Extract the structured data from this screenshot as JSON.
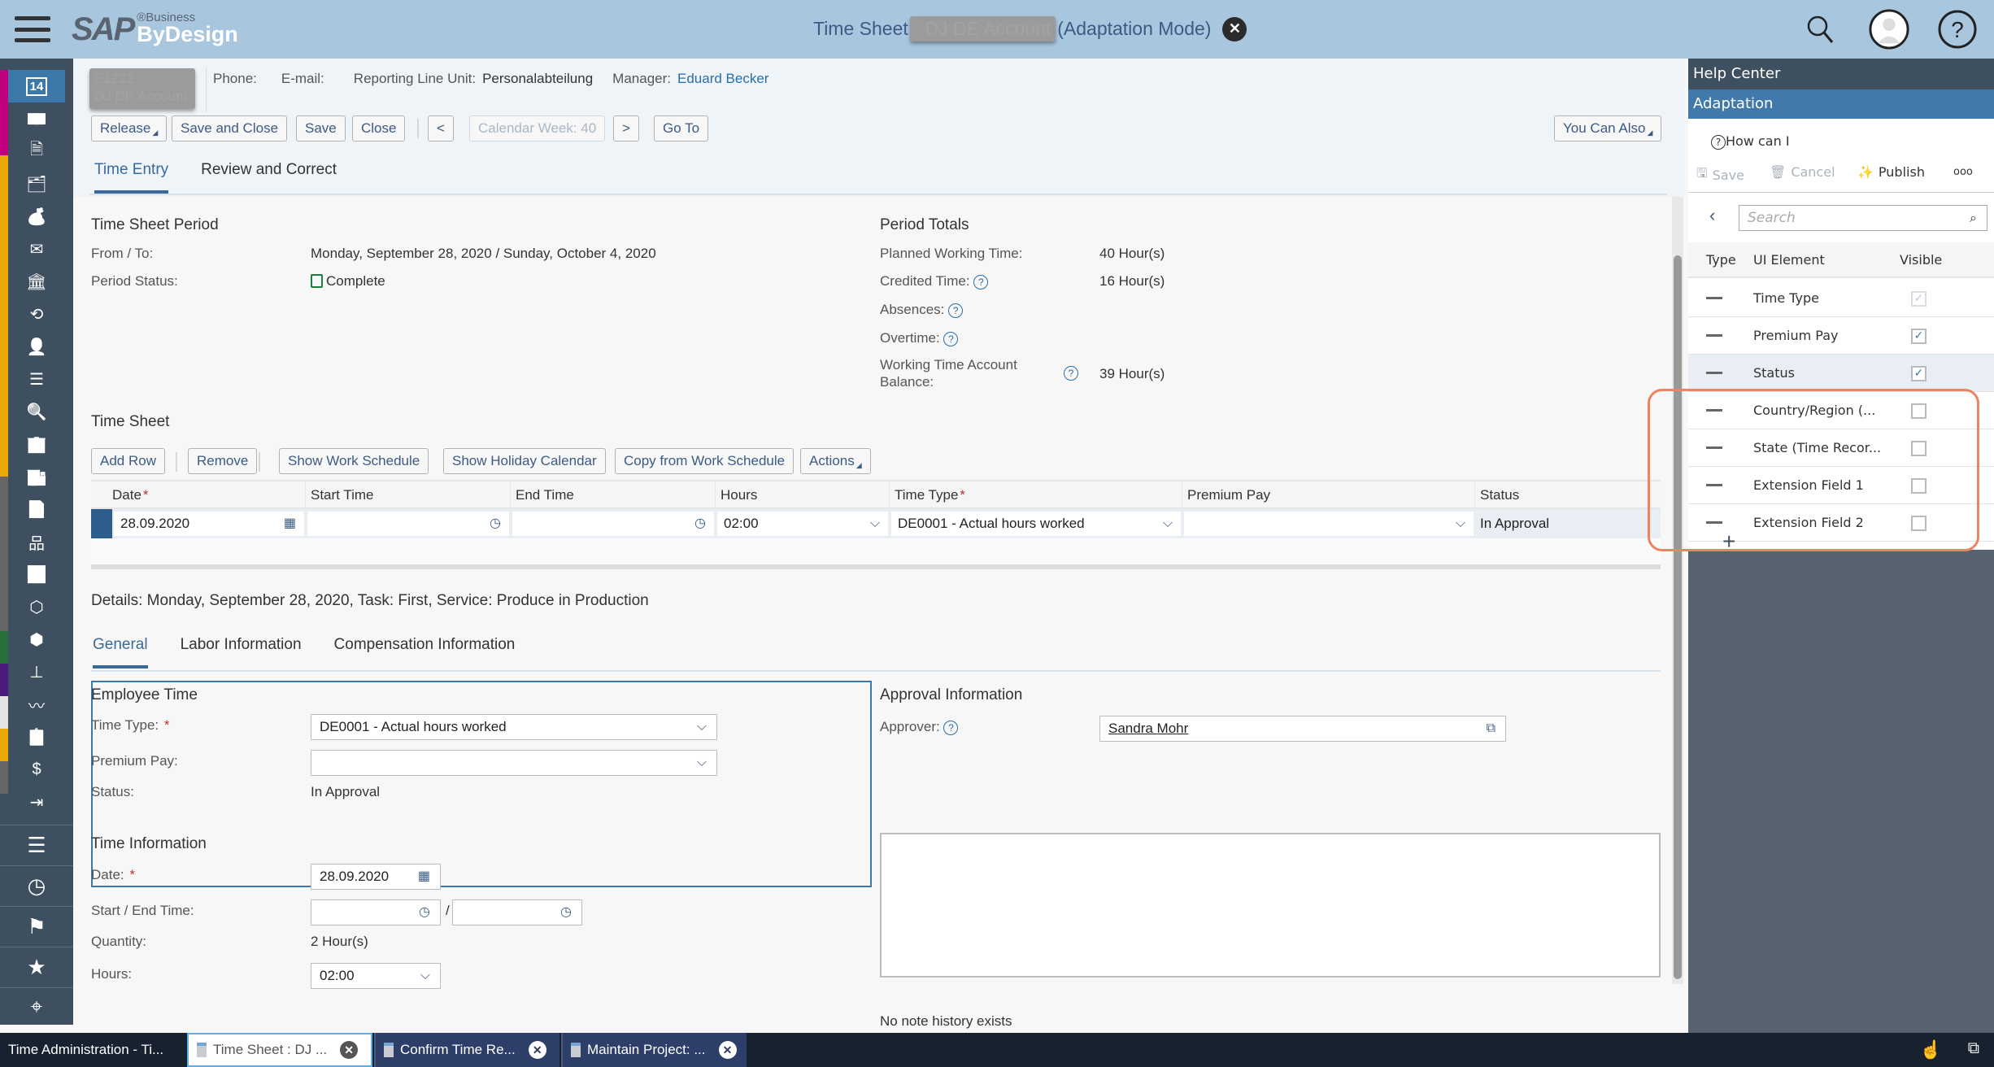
{
  "app": {
    "title_prefix": "Time Sheet",
    "title_masked": ": DJ DE Account",
    "title_suffix": "(Adaptation Mode)",
    "logo_main": "SAP",
    "logo_business": "®Business",
    "logo_bydesign": "ByDesign"
  },
  "topbar_icons": [
    "search-icon",
    "user-avatar-icon",
    "help-icon"
  ],
  "sidebar": {
    "icons": [
      "calendar-icon",
      "cash-icon",
      "invoice-icon",
      "folder-money-icon",
      "money-bag-icon",
      "envelope-money-icon",
      "bank-icon",
      "currency-exchange-icon",
      "customer-payment-icon",
      "list-icon",
      "tax-search-icon",
      "building-icon",
      "building-money-icon",
      "document-money-icon",
      "org-chart-icon",
      "analytics-icon",
      "box-icon",
      "product-icon",
      "hierarchy-icon",
      "chart-wave-icon",
      "clipboard-icon",
      "dollar-icon",
      "transfer-icon"
    ],
    "active_icon": "14",
    "bottom_icons": [
      "work-list-icon",
      "clock-icon",
      "flag-icon",
      "favorites-icon",
      "tag-icon"
    ]
  },
  "header": {
    "employee_id": "E1222",
    "employee_name": "DJ DE Account",
    "phone_label": "Phone:",
    "email_label": "E-mail:",
    "reporting_line_label": "Reporting Line Unit:",
    "reporting_line_value": "Personalabteilung",
    "manager_label": "Manager:",
    "manager_value": "Eduard Becker"
  },
  "toolbar": {
    "release": "Release",
    "save_close": "Save and Close",
    "save": "Save",
    "close": "Close",
    "prev": "<",
    "calendar_week": "Calendar Week: 40",
    "next": ">",
    "goto": "Go To",
    "you_can_also": "You Can Also"
  },
  "tabs": {
    "time_entry": "Time Entry",
    "review": "Review and Correct"
  },
  "period": {
    "title": "Time Sheet Period",
    "from_to_label": "From / To:",
    "from_to_value": "Monday, September 28, 2020 / Sunday, October 4, 2020",
    "status_label": "Period Status:",
    "status_value": "Complete"
  },
  "totals": {
    "title": "Period Totals",
    "planned_label": "Planned Working Time:",
    "planned_value": "40 Hour(s)",
    "credited_label": "Credited Time:",
    "credited_value": "16 Hour(s)",
    "absences_label": "Absences:",
    "overtime_label": "Overtime:",
    "wta_label_1": "Working Time Account",
    "wta_label_2": "Balance:",
    "wta_value": "39 Hour(s)"
  },
  "timesheet": {
    "title": "Time Sheet",
    "buttons": {
      "add_row": "Add Row",
      "remove": "Remove",
      "show_work": "Show Work Schedule",
      "show_holiday": "Show Holiday Calendar",
      "copy": "Copy from Work Schedule",
      "actions": "Actions"
    },
    "columns": [
      "Date",
      "Start Time",
      "End Time",
      "Hours",
      "Time Type",
      "Premium Pay",
      "Status"
    ],
    "rows": [
      {
        "date": "28.09.2020",
        "start": "",
        "end": "",
        "hours": "02:00",
        "time_type": "DE0001 - Actual hours worked",
        "premium": "",
        "status": "In Approval"
      }
    ]
  },
  "details": {
    "title": "Details: Monday, September 28, 2020, Task: First, Service: Produce in Production",
    "tabs": [
      "General",
      "Labor Information",
      "Compensation Information"
    ],
    "employee_time": {
      "title": "Employee Time",
      "time_type_label": "Time Type:",
      "time_type_value": "DE0001 - Actual hours worked",
      "premium_label": "Premium Pay:",
      "premium_value": "",
      "status_label": "Status:",
      "status_value": "In Approval"
    },
    "approval": {
      "title": "Approval Information",
      "approver_label": "Approver:",
      "approver_value": "Sandra Mohr"
    },
    "time_info": {
      "title": "Time Information",
      "date_label": "Date:",
      "date_value": "28.09.2020",
      "start_end_label": "Start / End Time:",
      "separator": "/",
      "quantity_label": "Quantity:",
      "quantity_value": "2 Hour(s)",
      "hours_label": "Hours:",
      "hours_value": "02:00"
    },
    "notes_history": "No note history exists"
  },
  "right_panel": {
    "help_center": "Help Center",
    "adaptation": "Adaptation",
    "how_can_i": "How can I",
    "save": "Save",
    "cancel": "Cancel",
    "publish": "Publish",
    "more": "ooo",
    "search_placeholder": "Search",
    "col_type": "Type",
    "col_element": "UI Element",
    "col_visible": "Visible",
    "rows": [
      {
        "name": "Time Type",
        "visible": true,
        "disabled": true
      },
      {
        "name": "Premium Pay",
        "visible": true,
        "disabled": false
      },
      {
        "name": "Status",
        "visible": true,
        "disabled": false
      },
      {
        "name": "Country/Region (...",
        "visible": false,
        "disabled": false
      },
      {
        "name": "State (Time Recor...",
        "visible": false,
        "disabled": false
      },
      {
        "name": "Extension Field 1",
        "visible": false,
        "disabled": false
      },
      {
        "name": "Extension Field 2",
        "visible": false,
        "disabled": false
      }
    ],
    "highlight_color": "#ec8460"
  },
  "taskbar": {
    "tabs": [
      {
        "label": "Time Administration - Ti...",
        "closable": false,
        "active": false
      },
      {
        "label": "Time Sheet : DJ ...",
        "closable": true,
        "active": true
      },
      {
        "label": "Confirm Time Re...",
        "closable": true,
        "active": false
      },
      {
        "label": "Maintain Project: ...",
        "closable": true,
        "active": false
      }
    ]
  },
  "colors": {
    "topbar": "#a9c6df",
    "accent": "#3d78ab",
    "sidebar": "#3e4f60",
    "taskbar": "#172130"
  }
}
